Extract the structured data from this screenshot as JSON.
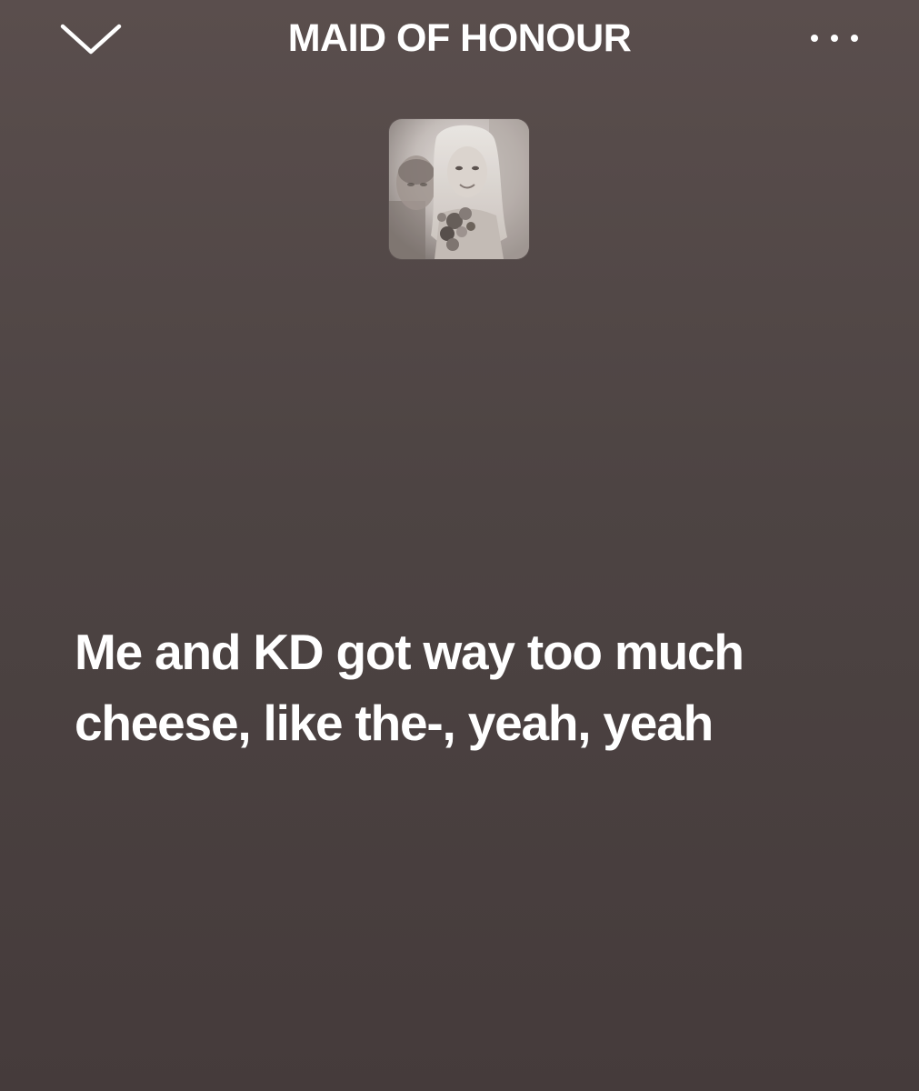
{
  "header": {
    "title": "MAID OF HONOUR",
    "collapse_icon": "chevron-down-icon",
    "more_icon": "more-horizontal-icon"
  },
  "artwork": {
    "icon": "album-art-image"
  },
  "lyrics": {
    "lines": [
      "Me and KD got way too much",
      "cheese, like the-, yeah, yeah"
    ]
  },
  "colors": {
    "background_top": "#5a4e4d",
    "background_bottom": "#453b3b",
    "text": "#ffffff"
  }
}
